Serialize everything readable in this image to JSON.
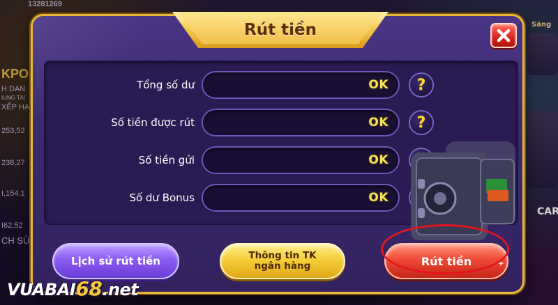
{
  "background": {
    "top_number": "13281269",
    "left_column": [
      "KPO",
      "H DAN",
      "IUNG TAI",
      "XẾP HẠ",
      "253,52",
      "238,27",
      "I,154,1",
      "I62,52",
      "CH SỬ"
    ],
    "right_column": [
      "Săng",
      "CAR"
    ]
  },
  "dialog": {
    "title": "Rút tiền",
    "close_label": "close"
  },
  "rows": [
    {
      "label": "Tổng số dư",
      "value": "OK",
      "help": "?"
    },
    {
      "label": "Số tiền được rút",
      "value": "OK",
      "help": "?"
    },
    {
      "label": "Số tiền gửi",
      "value": "OK",
      "help": "?"
    },
    {
      "label": "Số dư Bonus",
      "value": "OK",
      "help": "?"
    }
  ],
  "buttons": {
    "history": "Lịch sử rút tiền",
    "bank_line1": "Thông tin TK",
    "bank_line2": "ngân hàng",
    "withdraw": "Rút tiền"
  },
  "watermark": {
    "part1": "VUABAI",
    "part2": "68",
    "part3": ".net"
  },
  "colors": {
    "dialog_bg": "#3c2a6e",
    "border_gold": "#e9b73b",
    "value_yellow": "#f5e25a",
    "highlight_red": "#e3161b"
  },
  "icons": {
    "close": "close-x-icon",
    "help": "question-mark-icon",
    "safe": "safe-vault-icon"
  }
}
